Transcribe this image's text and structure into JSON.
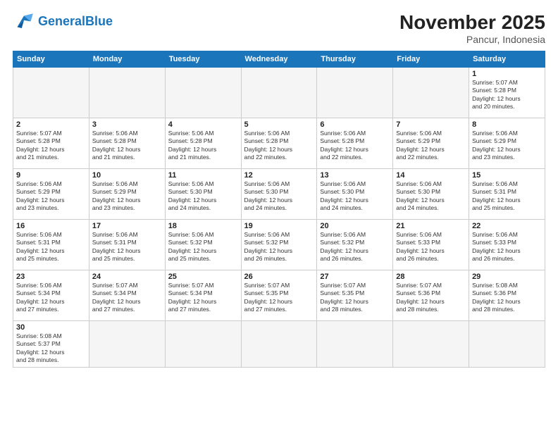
{
  "header": {
    "logo_general": "General",
    "logo_blue": "Blue",
    "month_year": "November 2025",
    "location": "Pancur, Indonesia"
  },
  "weekdays": [
    "Sunday",
    "Monday",
    "Tuesday",
    "Wednesday",
    "Thursday",
    "Friday",
    "Saturday"
  ],
  "weeks": [
    [
      {
        "day": "",
        "info": ""
      },
      {
        "day": "",
        "info": ""
      },
      {
        "day": "",
        "info": ""
      },
      {
        "day": "",
        "info": ""
      },
      {
        "day": "",
        "info": ""
      },
      {
        "day": "",
        "info": ""
      },
      {
        "day": "1",
        "info": "Sunrise: 5:07 AM\nSunset: 5:28 PM\nDaylight: 12 hours\nand 20 minutes."
      }
    ],
    [
      {
        "day": "2",
        "info": "Sunrise: 5:07 AM\nSunset: 5:28 PM\nDaylight: 12 hours\nand 21 minutes."
      },
      {
        "day": "3",
        "info": "Sunrise: 5:06 AM\nSunset: 5:28 PM\nDaylight: 12 hours\nand 21 minutes."
      },
      {
        "day": "4",
        "info": "Sunrise: 5:06 AM\nSunset: 5:28 PM\nDaylight: 12 hours\nand 21 minutes."
      },
      {
        "day": "5",
        "info": "Sunrise: 5:06 AM\nSunset: 5:28 PM\nDaylight: 12 hours\nand 22 minutes."
      },
      {
        "day": "6",
        "info": "Sunrise: 5:06 AM\nSunset: 5:28 PM\nDaylight: 12 hours\nand 22 minutes."
      },
      {
        "day": "7",
        "info": "Sunrise: 5:06 AM\nSunset: 5:29 PM\nDaylight: 12 hours\nand 22 minutes."
      },
      {
        "day": "8",
        "info": "Sunrise: 5:06 AM\nSunset: 5:29 PM\nDaylight: 12 hours\nand 23 minutes."
      }
    ],
    [
      {
        "day": "9",
        "info": "Sunrise: 5:06 AM\nSunset: 5:29 PM\nDaylight: 12 hours\nand 23 minutes."
      },
      {
        "day": "10",
        "info": "Sunrise: 5:06 AM\nSunset: 5:29 PM\nDaylight: 12 hours\nand 23 minutes."
      },
      {
        "day": "11",
        "info": "Sunrise: 5:06 AM\nSunset: 5:30 PM\nDaylight: 12 hours\nand 24 minutes."
      },
      {
        "day": "12",
        "info": "Sunrise: 5:06 AM\nSunset: 5:30 PM\nDaylight: 12 hours\nand 24 minutes."
      },
      {
        "day": "13",
        "info": "Sunrise: 5:06 AM\nSunset: 5:30 PM\nDaylight: 12 hours\nand 24 minutes."
      },
      {
        "day": "14",
        "info": "Sunrise: 5:06 AM\nSunset: 5:30 PM\nDaylight: 12 hours\nand 24 minutes."
      },
      {
        "day": "15",
        "info": "Sunrise: 5:06 AM\nSunset: 5:31 PM\nDaylight: 12 hours\nand 25 minutes."
      }
    ],
    [
      {
        "day": "16",
        "info": "Sunrise: 5:06 AM\nSunset: 5:31 PM\nDaylight: 12 hours\nand 25 minutes."
      },
      {
        "day": "17",
        "info": "Sunrise: 5:06 AM\nSunset: 5:31 PM\nDaylight: 12 hours\nand 25 minutes."
      },
      {
        "day": "18",
        "info": "Sunrise: 5:06 AM\nSunset: 5:32 PM\nDaylight: 12 hours\nand 25 minutes."
      },
      {
        "day": "19",
        "info": "Sunrise: 5:06 AM\nSunset: 5:32 PM\nDaylight: 12 hours\nand 26 minutes."
      },
      {
        "day": "20",
        "info": "Sunrise: 5:06 AM\nSunset: 5:32 PM\nDaylight: 12 hours\nand 26 minutes."
      },
      {
        "day": "21",
        "info": "Sunrise: 5:06 AM\nSunset: 5:33 PM\nDaylight: 12 hours\nand 26 minutes."
      },
      {
        "day": "22",
        "info": "Sunrise: 5:06 AM\nSunset: 5:33 PM\nDaylight: 12 hours\nand 26 minutes."
      }
    ],
    [
      {
        "day": "23",
        "info": "Sunrise: 5:06 AM\nSunset: 5:34 PM\nDaylight: 12 hours\nand 27 minutes."
      },
      {
        "day": "24",
        "info": "Sunrise: 5:07 AM\nSunset: 5:34 PM\nDaylight: 12 hours\nand 27 minutes."
      },
      {
        "day": "25",
        "info": "Sunrise: 5:07 AM\nSunset: 5:34 PM\nDaylight: 12 hours\nand 27 minutes."
      },
      {
        "day": "26",
        "info": "Sunrise: 5:07 AM\nSunset: 5:35 PM\nDaylight: 12 hours\nand 27 minutes."
      },
      {
        "day": "27",
        "info": "Sunrise: 5:07 AM\nSunset: 5:35 PM\nDaylight: 12 hours\nand 28 minutes."
      },
      {
        "day": "28",
        "info": "Sunrise: 5:07 AM\nSunset: 5:36 PM\nDaylight: 12 hours\nand 28 minutes."
      },
      {
        "day": "29",
        "info": "Sunrise: 5:08 AM\nSunset: 5:36 PM\nDaylight: 12 hours\nand 28 minutes."
      }
    ],
    [
      {
        "day": "30",
        "info": "Sunrise: 5:08 AM\nSunset: 5:37 PM\nDaylight: 12 hours\nand 28 minutes."
      },
      {
        "day": "",
        "info": ""
      },
      {
        "day": "",
        "info": ""
      },
      {
        "day": "",
        "info": ""
      },
      {
        "day": "",
        "info": ""
      },
      {
        "day": "",
        "info": ""
      },
      {
        "day": "",
        "info": ""
      }
    ]
  ]
}
